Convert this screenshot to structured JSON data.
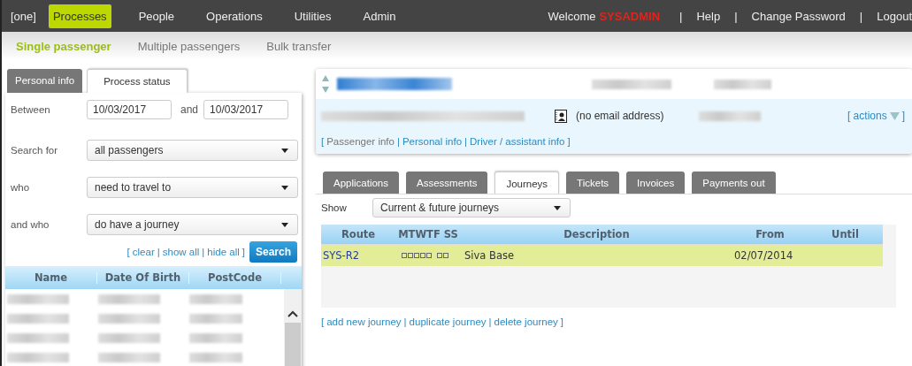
{
  "top_nav": {
    "brand": "[one]",
    "items": [
      {
        "label": "Processes",
        "selected": true
      },
      {
        "label": "People",
        "selected": false
      },
      {
        "label": "Operations",
        "selected": false
      },
      {
        "label": "Utilities",
        "selected": false
      },
      {
        "label": "Admin",
        "selected": false
      }
    ],
    "welcome": "Welcome",
    "user": "SYSADMIN",
    "links": [
      "Help",
      "Change Password",
      "Logout"
    ],
    "separator": "|"
  },
  "sub_nav": [
    {
      "label": "Single passenger",
      "selected": true
    },
    {
      "label": "Multiple passengers",
      "selected": false
    },
    {
      "label": "Bulk transfer",
      "selected": false
    }
  ],
  "search_panel": {
    "tabs": [
      {
        "label": "Personal info",
        "selected": false
      },
      {
        "label": "Process status",
        "selected": true
      }
    ],
    "between": {
      "label": "Between",
      "from": "10/03/2017",
      "joiner": "and",
      "to": "10/03/2017"
    },
    "filters": [
      {
        "label": "Search for",
        "value": "all passengers"
      },
      {
        "label": "who",
        "value": "need to travel to"
      },
      {
        "label": "and who",
        "value": "do have a journey"
      }
    ],
    "links": {
      "open": "[",
      "separator": "|",
      "close": "]",
      "items": [
        "clear",
        "show all",
        "hide all"
      ]
    },
    "search_button": "Search",
    "columns": [
      "Name",
      "Date Of Birth",
      "PostCode"
    ]
  },
  "passenger": {
    "email": "(no email address)",
    "actions": {
      "open": "[",
      "label": "actions",
      "close": "]"
    },
    "links": {
      "open": "[",
      "separator": "|",
      "close": "]",
      "items": [
        {
          "label": "Passenger info",
          "selected": true
        },
        {
          "label": "Personal info",
          "selected": false
        },
        {
          "label": "Driver / assistant info",
          "selected": false
        }
      ]
    }
  },
  "tabs": [
    {
      "label": "Applications",
      "selected": false
    },
    {
      "label": "Assessments",
      "selected": false
    },
    {
      "label": "Journeys",
      "selected": true
    },
    {
      "label": "Tickets",
      "selected": false
    },
    {
      "label": "Invoices",
      "selected": false
    },
    {
      "label": "Payments out",
      "selected": false
    }
  ],
  "show": {
    "label": "Show",
    "value": "Current & future journeys"
  },
  "journeys": {
    "columns": [
      "Route",
      "MTWTF SS",
      "Description",
      "From",
      "Until"
    ],
    "rows": [
      {
        "route": "SYS-R2",
        "description": "Siva Base",
        "from": "02/07/2014",
        "selected": true
      }
    ]
  },
  "journey_links": {
    "open": "[",
    "separator": "|",
    "close": "]",
    "items": [
      "add new journey",
      "duplicate journey",
      "delete journey"
    ]
  }
}
